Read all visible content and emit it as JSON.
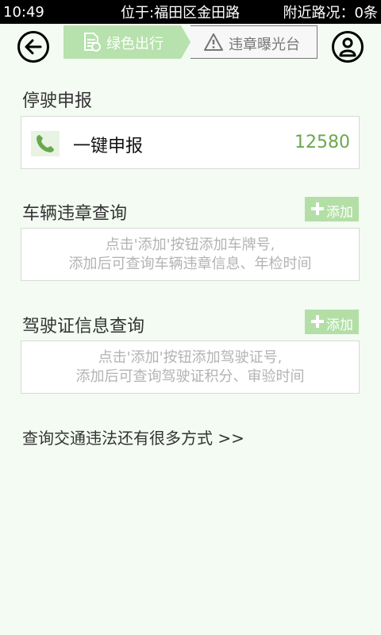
{
  "status_bar": {
    "time": "10:49",
    "location": "位于:福田区金田路",
    "traffic": "附近路况：0条"
  },
  "header": {
    "tabs": [
      {
        "label": "绿色出行",
        "icon": "document-icon",
        "active": true
      },
      {
        "label": "违章曝光台",
        "icon": "warning-icon",
        "active": false
      }
    ]
  },
  "report": {
    "title": "停驶申报",
    "item_label": "一键申报",
    "item_number": "12580"
  },
  "vehicle": {
    "title": "车辆违章查询",
    "add_label": "添加",
    "hint_line1": "点击'添加'按钮添加车牌号,",
    "hint_line2": "添加后可查询车辆违章信息、年检时间"
  },
  "license": {
    "title": "驾驶证信息查询",
    "add_label": "添加",
    "hint_line1": "点击'添加'按钮添加驾驶证号,",
    "hint_line2": "添加后可查询驾驶证积分、审验时间"
  },
  "more_link": "查询交通违法还有很多方式 >>",
  "colors": {
    "accent_green": "#b3dfa7",
    "number_green": "#6aa84f",
    "background": "#f3fbf2"
  }
}
